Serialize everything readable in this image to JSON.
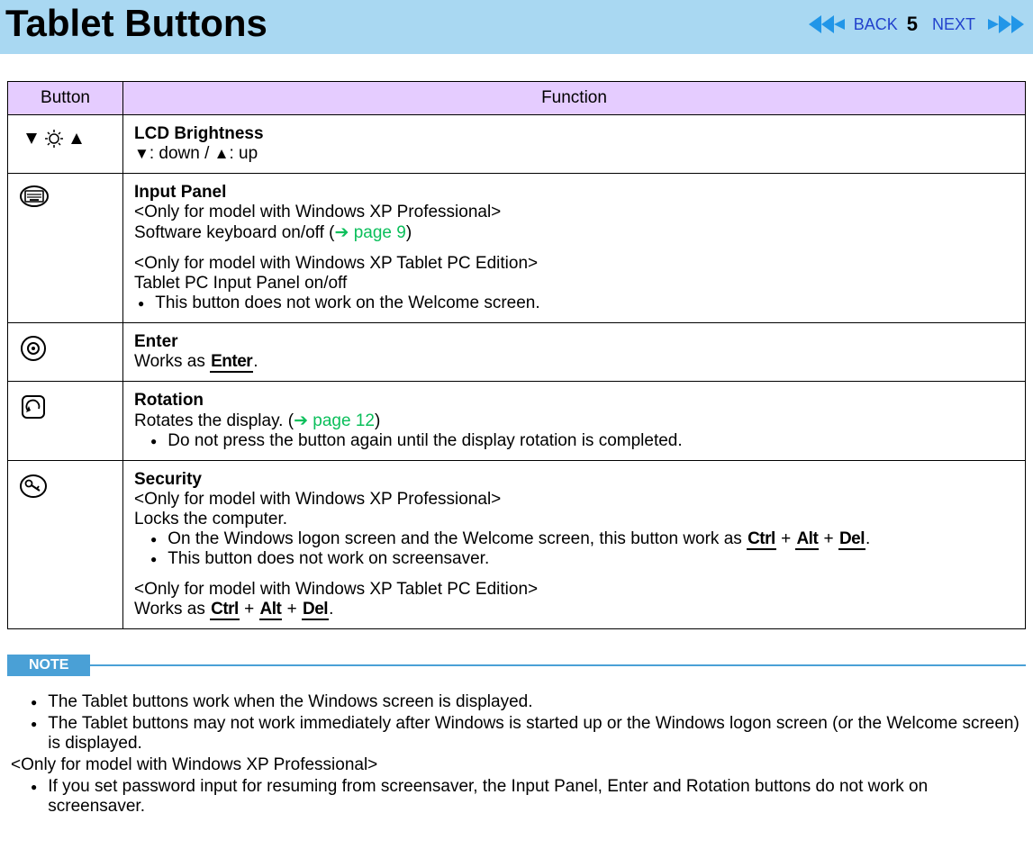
{
  "header": {
    "title": "Tablet Buttons",
    "back_label": "BACK",
    "next_label": "NEXT",
    "page_number": "5"
  },
  "table": {
    "col_button": "Button",
    "col_function": "Function",
    "row1": {
      "title": "LCD Brightness",
      "desc_pre": ": down / ",
      "desc_post": ": up"
    },
    "row2": {
      "title": "Input Panel",
      "p1a": "<Only for model with Windows XP Professional>",
      "p1b_pre": "Software keyboard on/off (",
      "p1b_link": " page 9",
      "p1b_post": ")",
      "p2a": "<Only for model with Windows XP Tablet PC Edition>",
      "p2b": "Tablet PC Input Panel on/off",
      "bullet1": "This button does not work on the Welcome screen."
    },
    "row3": {
      "title": "Enter",
      "pre": "Works as ",
      "key": "Enter",
      "post": "."
    },
    "row4": {
      "title": "Rotation",
      "pre": "Rotates the display. (",
      "link": " page 12",
      "post": ")",
      "bullet1": "Do not press the button again until the display rotation is completed."
    },
    "row5": {
      "title": "Security",
      "p1a": "<Only for model with Windows XP Professional>",
      "p1b": "Locks the computer.",
      "b1_pre": "On the Windows logon screen and the Welcome screen, this button work as ",
      "k_ctrl": "Ctrl",
      "plus": " + ",
      "k_alt": "Alt",
      "k_del": "Del",
      "b1_post": ".",
      "b2": "This button does not work on screensaver.",
      "p2a": "<Only for model with Windows XP Tablet PC Edition>",
      "p2b_pre": "Works as ",
      "p2b_post": "."
    }
  },
  "note": {
    "label": "NOTE",
    "b1": "The Tablet buttons work when the Windows screen is displayed.",
    "b2": "The Tablet buttons may not work immediately after Windows is started up or the Windows logon screen (or the Welcome screen) is displayed.",
    "plain": "<Only for model with Windows XP Professional>",
    "b3": "If you set password input for resuming from screensaver, the Input Panel, Enter and Rotation buttons do not work on screensaver."
  }
}
